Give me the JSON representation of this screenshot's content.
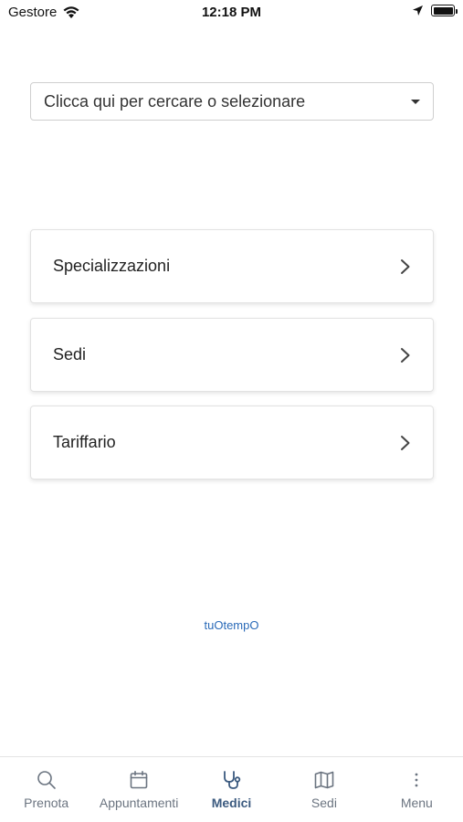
{
  "status_bar": {
    "carrier": "Gestore",
    "time": "12:18 PM"
  },
  "search": {
    "placeholder": "Clicca qui per cercare o selezionare"
  },
  "menu_cards": [
    {
      "label": "Specializzazioni"
    },
    {
      "label": "Sedi"
    },
    {
      "label": "Tariffario"
    }
  ],
  "brand": "tuOtempO",
  "tabs": [
    {
      "label": "Prenota",
      "icon": "search-icon"
    },
    {
      "label": "Appuntamenti",
      "icon": "calendar-icon"
    },
    {
      "label": "Medici",
      "icon": "stethoscope-icon",
      "active": true
    },
    {
      "label": "Sedi",
      "icon": "map-icon"
    },
    {
      "label": "Menu",
      "icon": "more-vertical-icon"
    }
  ],
  "colors": {
    "accent": "#3b5a7f",
    "brand_link": "#2a6ab8",
    "inactive_tab": "#6b7480"
  }
}
